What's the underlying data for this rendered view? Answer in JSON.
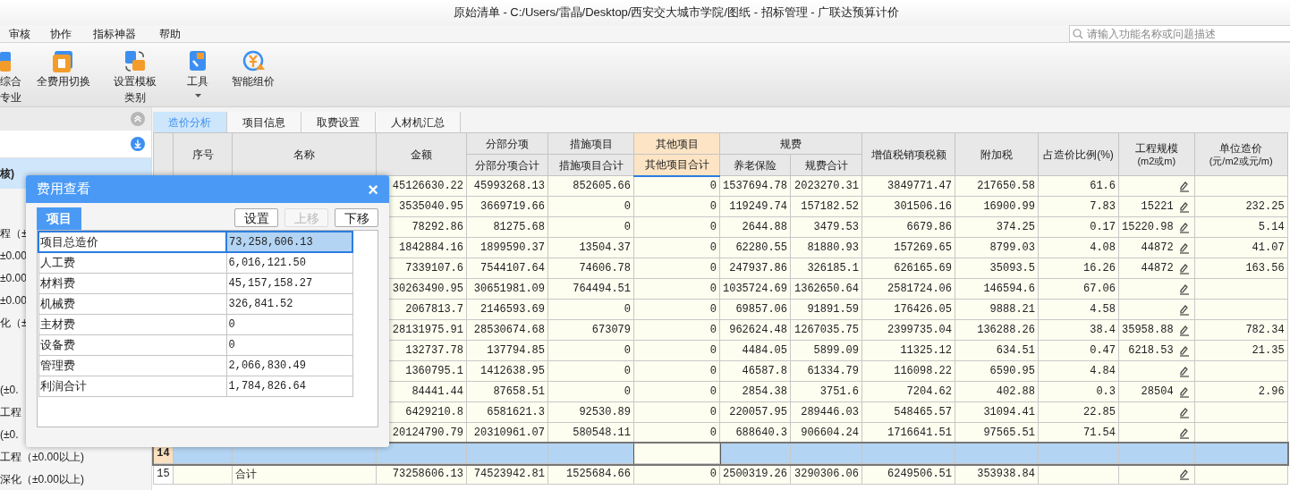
{
  "window": {
    "title": "原始清单 - C:/Users/雷晶/Desktop/西安交大城市学院/图纸 - 招标管理 - 广联达预算计价"
  },
  "menu": [
    "审核",
    "协作",
    "指标神器",
    "帮助"
  ],
  "search": {
    "placeholder": "请输入功能名称或问题描述"
  },
  "ribbon": [
    {
      "lines": [
        "综合",
        "专业"
      ],
      "dropdown": false
    },
    {
      "lines": [
        "全费用切换"
      ],
      "dropdown": false
    },
    {
      "lines": [
        "设置模板",
        "类别"
      ],
      "dropdown": false
    },
    {
      "lines": [
        "工具"
      ],
      "dropdown": true
    },
    {
      "lines": [
        "智能组价"
      ],
      "dropdown": false
    }
  ],
  "left_panel": {
    "items": [
      {
        "label": "核)",
        "selected": true
      },
      {
        "label": "程（±",
        "selected": false
      },
      {
        "label": "±0.00",
        "selected": false
      },
      {
        "label": "±0.00",
        "selected": false
      },
      {
        "label": "±0.00",
        "selected": false
      },
      {
        "label": "化（±",
        "selected": false
      },
      {
        "label": "(±0.",
        "selected": false
      },
      {
        "label": "工程",
        "selected": false
      },
      {
        "label": "(±0.",
        "selected": false
      },
      {
        "label": "工程（±0.00以上)",
        "selected": false
      },
      {
        "label": "深化（±0.00以上)",
        "selected": false
      }
    ]
  },
  "tabs": [
    {
      "label": "造价分析",
      "selected": true
    },
    {
      "label": "项目信息",
      "selected": false
    },
    {
      "label": "取费设置",
      "selected": false
    },
    {
      "label": "人材机汇总",
      "selected": false
    }
  ],
  "table": {
    "columns": [
      {
        "label": "序号"
      },
      {
        "label": "名称"
      },
      {
        "label": "金额"
      },
      {
        "group": "分部分项",
        "highlighted": false,
        "children": [
          {
            "label": "分部分项合计"
          }
        ]
      },
      {
        "group": "措施项目",
        "highlighted": false,
        "children": [
          {
            "label": "措施项目合计"
          }
        ]
      },
      {
        "group": "其他项目",
        "highlighted": true,
        "children": [
          {
            "label": "其他项目合计"
          }
        ]
      },
      {
        "group": "规费",
        "highlighted": false,
        "children": [
          {
            "label": "养老保险"
          },
          {
            "label": "规费合计"
          }
        ]
      },
      {
        "label": "增值税销项税额"
      },
      {
        "label": "附加税"
      },
      {
        "label": "占造价比例(%)"
      },
      {
        "label": "工程规模",
        "sub": "(m2或m)"
      },
      {
        "label": "单位造价",
        "sub": "(元/m2或元/m)"
      }
    ],
    "rows": [
      {
        "selected": false,
        "editable": true,
        "values": [
          "45126630.22",
          "45993268.13",
          "852605.66",
          "0",
          "1537694.78",
          "2023270.31",
          "3849771.47",
          "217650.58",
          "61.6"
        ]
      },
      {
        "selected": false,
        "editable": true,
        "values": [
          "3535040.95",
          "3669719.66",
          "0",
          "0",
          "119249.74",
          "157182.52",
          "301506.16",
          "16900.99",
          "7.83",
          "15221",
          "232.25"
        ]
      },
      {
        "selected": false,
        "editable": true,
        "values": [
          "78292.86",
          "81275.68",
          "0",
          "0",
          "2644.88",
          "3479.53",
          "6679.86",
          "374.25",
          "0.17",
          "15220.98",
          "5.14"
        ]
      },
      {
        "selected": false,
        "editable": true,
        "values": [
          "1842884.16",
          "1899590.37",
          "13504.37",
          "0",
          "62280.55",
          "81880.93",
          "157269.65",
          "8799.03",
          "4.08",
          "44872",
          "41.07"
        ]
      },
      {
        "selected": false,
        "editable": true,
        "values": [
          "7339107.6",
          "7544107.64",
          "74606.78",
          "0",
          "247937.86",
          "326185.1",
          "626165.69",
          "35093.5",
          "16.26",
          "44872",
          "163.56"
        ]
      },
      {
        "selected": false,
        "editable": true,
        "values": [
          "30263490.95",
          "30651981.09",
          "764494.51",
          "0",
          "1035724.69",
          "1362650.64",
          "2581724.06",
          "146594.6",
          "67.06"
        ]
      },
      {
        "selected": false,
        "editable": true,
        "values": [
          "2067813.7",
          "2146593.69",
          "0",
          "0",
          "69857.06",
          "91891.59",
          "176426.05",
          "9888.21",
          "4.58"
        ]
      },
      {
        "selected": false,
        "editable": true,
        "values": [
          "28131975.91",
          "28530674.68",
          "673079",
          "0",
          "962624.48",
          "1267035.75",
          "2399735.04",
          "136288.26",
          "38.4",
          "35958.88",
          "782.34"
        ]
      },
      {
        "selected": false,
        "editable": true,
        "values": [
          "132737.78",
          "137794.85",
          "0",
          "0",
          "4484.05",
          "5899.09",
          "11325.12",
          "634.51",
          "0.47",
          "6218.53",
          "21.35"
        ]
      },
      {
        "selected": false,
        "editable": true,
        "values": [
          "1360795.1",
          "1412638.95",
          "0",
          "0",
          "46587.8",
          "61334.79",
          "116098.22",
          "6590.95",
          "4.84"
        ]
      },
      {
        "selected": false,
        "editable": true,
        "values": [
          "84441.44",
          "87658.51",
          "0",
          "0",
          "2854.38",
          "3751.6",
          "7204.62",
          "402.88",
          "0.3",
          "28504",
          "2.96"
        ]
      },
      {
        "selected": false,
        "editable": true,
        "values": [
          "6429210.8",
          "6581621.3",
          "92530.89",
          "0",
          "220057.95",
          "289446.03",
          "548465.57",
          "31094.41",
          "22.85"
        ]
      },
      {
        "selected": false,
        "editable": true,
        "values": [
          "20124790.79",
          "20310961.07",
          "580548.11",
          "0",
          "688640.3",
          "906604.24",
          "1716641.51",
          "97565.51",
          "71.54"
        ]
      },
      {
        "number": "14",
        "selected": true,
        "editable": false
      },
      {
        "number": "15",
        "name": "合计",
        "selected": false,
        "editable": true,
        "values": [
          "73258606.13",
          "74523942.81",
          "1525684.66",
          "0",
          "2500319.26",
          "3290306.06",
          "6249506.51",
          "353938.84"
        ]
      }
    ]
  },
  "dialog": {
    "title": "费用查看",
    "close": "×",
    "tab": "项目",
    "buttons": [
      {
        "label": "设置",
        "disabled": false
      },
      {
        "label": "上移",
        "disabled": true
      },
      {
        "label": "下移",
        "disabled": false
      }
    ],
    "rows": [
      {
        "label": "项目总造价",
        "value": "73,258,606.13",
        "selected": true
      },
      {
        "label": "人工费",
        "value": "6,016,121.50",
        "selected": false
      },
      {
        "label": "材料费",
        "value": "45,157,158.27",
        "selected": false
      },
      {
        "label": "机械费",
        "value": "326,841.52",
        "selected": false
      },
      {
        "label": "主材费",
        "value": "0",
        "selected": false
      },
      {
        "label": "设备费",
        "value": "0",
        "selected": false
      },
      {
        "label": "管理费",
        "value": "2,066,830.49",
        "selected": false
      },
      {
        "label": "利润合计",
        "value": "1,784,826.64",
        "selected": false
      }
    ]
  }
}
